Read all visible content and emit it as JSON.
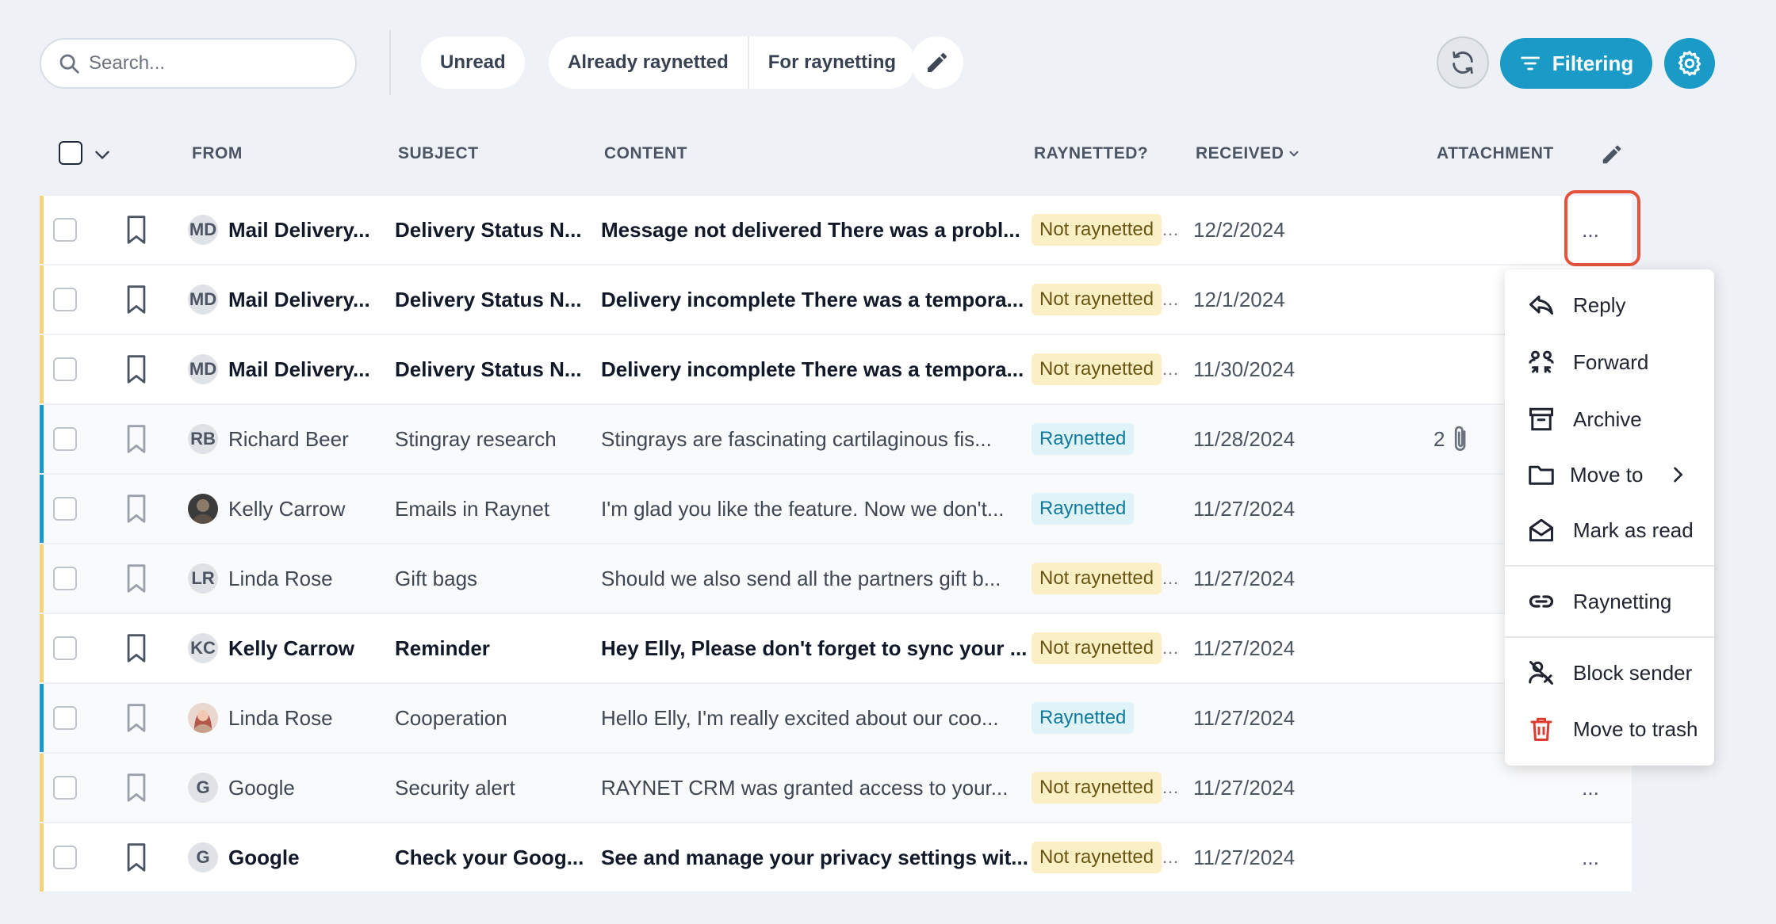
{
  "search": {
    "placeholder": "Search..."
  },
  "filters": {
    "unread": "Unread",
    "already_raynetted": "Already raynetted",
    "for_raynetting": "For raynetting"
  },
  "actions": {
    "filtering": "Filtering"
  },
  "colors": {
    "accent": "#1a9bc7",
    "unraynetted_bar": "#f3d37b",
    "highlight": "#e5533d",
    "trash": "#dc3b30"
  },
  "columns": {
    "from": "FROM",
    "subject": "SUBJECT",
    "content": "CONTENT",
    "raynetted": "RAYNETTED?",
    "received": "RECEIVED",
    "attachment": "ATTACHMENT"
  },
  "rows": [
    {
      "initials": "MD",
      "from": "Mail Delivery...",
      "subject": "Delivery Status N...",
      "content": "Message not delivered There was a probl...",
      "status": "Not raynetted",
      "received": "12/2/2024",
      "attachments": "",
      "unread": true
    },
    {
      "initials": "MD",
      "from": "Mail Delivery...",
      "subject": "Delivery Status N...",
      "content": "Delivery incomplete There was a tempora...",
      "status": "Not raynetted",
      "received": "12/1/2024",
      "attachments": "",
      "unread": true
    },
    {
      "initials": "MD",
      "from": "Mail Delivery...",
      "subject": "Delivery Status N...",
      "content": "Delivery incomplete There was a tempora...",
      "status": "Not raynetted",
      "received": "11/30/2024",
      "attachments": "",
      "unread": true
    },
    {
      "initials": "RB",
      "from": "Richard Beer",
      "subject": "Stingray research",
      "content": "Stingrays are fascinating cartilaginous fis...",
      "status": "Raynetted",
      "received": "11/28/2024",
      "attachments": "2",
      "unread": false
    },
    {
      "initials": "",
      "from": "Kelly Carrow",
      "subject": "Emails in Raynet",
      "content": "I'm glad you like the feature. Now we don't...",
      "status": "Raynetted",
      "received": "11/27/2024",
      "attachments": "",
      "unread": false
    },
    {
      "initials": "LR",
      "from": "Linda Rose",
      "subject": "Gift bags",
      "content": "Should we also send all the partners gift b...",
      "status": "Not raynetted",
      "received": "11/27/2024",
      "attachments": "",
      "unread": false
    },
    {
      "initials": "KC",
      "from": "Kelly Carrow",
      "subject": "Reminder",
      "content": "Hey Elly, Please don't forget to sync your ...",
      "status": "Not raynetted",
      "received": "11/27/2024",
      "attachments": "",
      "unread": true
    },
    {
      "initials": "",
      "from": "Linda Rose",
      "subject": "Cooperation",
      "content": "Hello Elly, I'm really excited about our coo...",
      "status": "Raynetted",
      "received": "11/27/2024",
      "attachments": "",
      "unread": false
    },
    {
      "initials": "G",
      "from": "Google",
      "subject": "Security alert",
      "content": "RAYNET CRM was granted access to your...",
      "status": "Not raynetted",
      "received": "11/27/2024",
      "attachments": "",
      "unread": false
    },
    {
      "initials": "G",
      "from": "Google",
      "subject": "Check your Goog...",
      "content": "See and manage your privacy settings wit...",
      "status": "Not raynetted",
      "received": "11/27/2024",
      "attachments": "",
      "unread": true
    }
  ],
  "row_menu_label": "...",
  "context_menu": {
    "reply": "Reply",
    "forward": "Forward",
    "archive": "Archive",
    "move_to": "Move to",
    "mark_as_read": "Mark as read",
    "raynetting": "Raynetting",
    "block_sender": "Block sender",
    "move_to_trash": "Move to trash"
  }
}
